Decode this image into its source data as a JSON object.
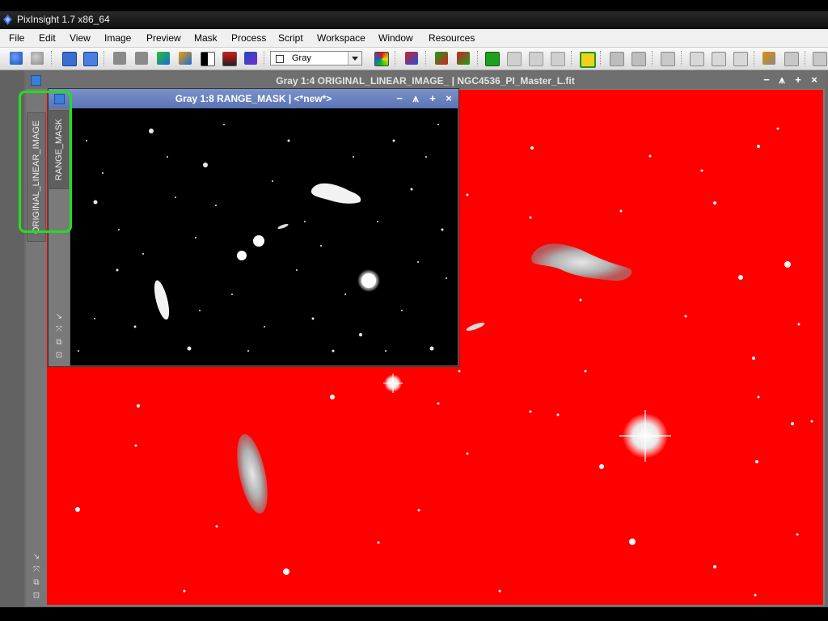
{
  "app": {
    "title": "PixInsight 1.7 x86_64"
  },
  "menubar": {
    "items": [
      "File",
      "Edit",
      "View",
      "Image",
      "Preview",
      "Mask",
      "Process",
      "Script",
      "Workspace",
      "Window",
      "Resources"
    ]
  },
  "toolbar": {
    "channel_select": "Gray"
  },
  "main_window": {
    "title": "Gray 1:4 ORIGINAL_LINEAR_IMAGE_ | NGC4536_PI_Master_L.fit",
    "side_tab": "ORIGINAL_LINEAR_IMAGE"
  },
  "mask_window": {
    "title": "Gray 1:8 RANGE_MASK | <*new*>",
    "side_tab": "RANGE_MASK"
  },
  "window_buttons": {
    "minimize": "−",
    "shade": "⩚",
    "maximize": "+",
    "close": "×"
  },
  "colors": {
    "mask_overlay": "#ff0000",
    "highlight": "#22dd22",
    "mask_title": "#5a74b6"
  }
}
